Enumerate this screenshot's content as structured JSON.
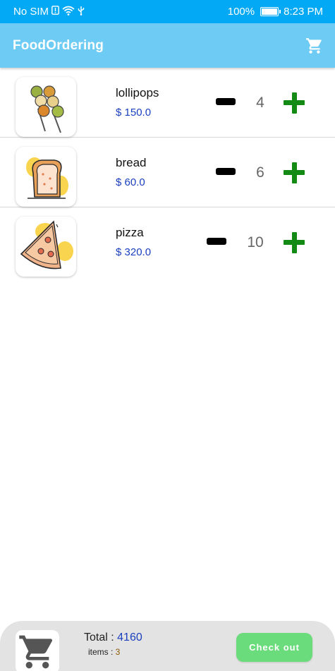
{
  "status_bar": {
    "carrier": "No SIM",
    "battery": "100%",
    "time": "8:23 PM",
    "icons": [
      "sim-icon",
      "wifi-icon",
      "usb-icon",
      "battery-icon"
    ]
  },
  "app_bar": {
    "title": "FoodOrdering",
    "cart_icon": "cart-icon"
  },
  "items": [
    {
      "name": "lollipops",
      "price": "$ 150.0",
      "quantity": "4",
      "image_icon": "lollipops-icon"
    },
    {
      "name": "bread",
      "price": "$ 60.0",
      "quantity": "6",
      "image_icon": "bread-icon"
    },
    {
      "name": "pizza",
      "price": "$ 320.0",
      "quantity": "10",
      "image_icon": "pizza-icon"
    }
  ],
  "summary": {
    "total_label": "Total : ",
    "total_value": "4160",
    "items_label": "items : ",
    "items_value": "3",
    "checkout_label": "Check out",
    "cart_icon": "cart-icon"
  },
  "colors": {
    "status_bar": "#03a9f4",
    "app_bar": "#6ecbf4",
    "price": "#1a3fbf",
    "plus": "#138a13",
    "checkout": "#6bdc7b",
    "bottom_bar": "#e3e3e3"
  }
}
